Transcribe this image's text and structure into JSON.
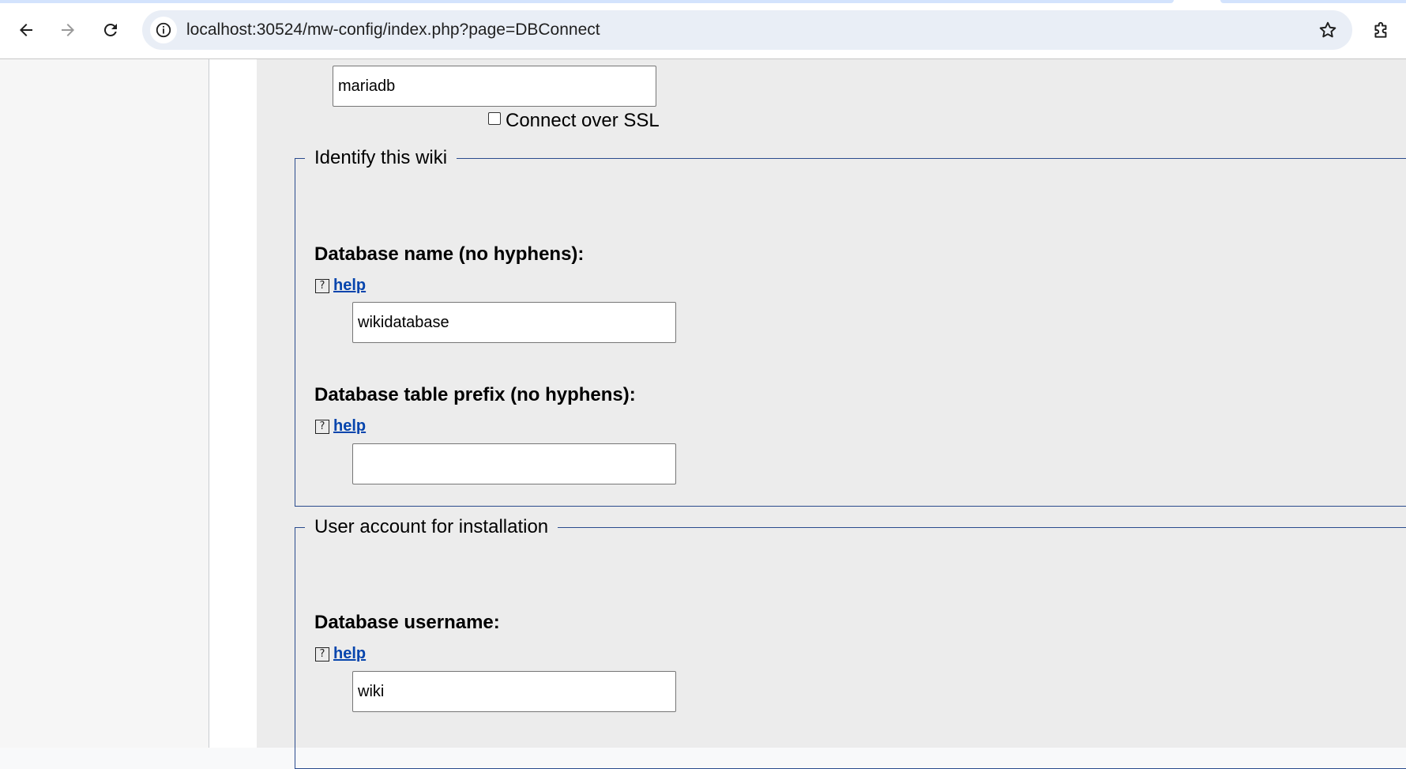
{
  "browser": {
    "url": "localhost:30524/mw-config/index.php?page=DBConnect",
    "icons": {
      "back": "back-arrow-icon",
      "forward": "forward-arrow-icon",
      "reload": "reload-icon",
      "site_info": "info-icon",
      "bookmark": "star-icon",
      "extensions": "puzzle-piece-icon"
    }
  },
  "form": {
    "db_host_value": "mariadb",
    "ssl_label": "Connect over SSL",
    "identify_section": {
      "legend": "Identify this wiki",
      "db_name_label": "Database name (no hyphens):",
      "db_name_help": "help",
      "db_name_value": "wikidatabase",
      "table_prefix_label": "Database table prefix (no hyphens):",
      "table_prefix_help": "help",
      "table_prefix_value": ""
    },
    "user_section": {
      "legend": "User account for installation",
      "db_user_label": "Database username:",
      "db_user_help": "help",
      "db_user_value": "wiki"
    }
  },
  "colors": {
    "link": "#0645ad",
    "fieldset_border": "#2a4b8d",
    "content_bg": "#ececec"
  }
}
